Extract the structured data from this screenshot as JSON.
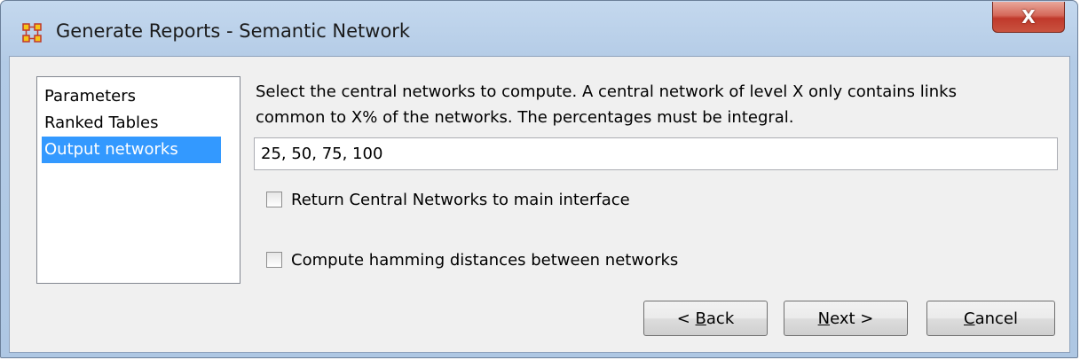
{
  "window": {
    "title": "Generate Reports - Semantic Network",
    "close_glyph": "X",
    "icon": "app-network-icon"
  },
  "nav": {
    "items": [
      {
        "label": "Parameters",
        "selected": false
      },
      {
        "label": "Ranked Tables",
        "selected": false
      },
      {
        "label": "Output networks",
        "selected": true
      }
    ]
  },
  "main": {
    "description_line1": "Select the central networks to compute. A central network of level X only contains links",
    "description_line2": "common to X% of the networks. The percentages must be integral.",
    "percentages_value": "25, 50, 75, 100",
    "checkbox_return_central": {
      "label": "Return Central Networks to main interface",
      "checked": false
    },
    "checkbox_hamming": {
      "label": "Compute hamming distances between networks",
      "checked": false
    }
  },
  "buttons": {
    "back": {
      "prefix": "< ",
      "mnemonic": "B",
      "rest": "ack"
    },
    "next": {
      "prefix": "",
      "mnemonic": "N",
      "rest": "ext >"
    },
    "cancel": {
      "prefix": "",
      "mnemonic": "C",
      "rest": "ancel"
    }
  },
  "colors": {
    "selection": "#3399ff",
    "close_button": "#c0392b",
    "frame": "#b3cbe6"
  }
}
